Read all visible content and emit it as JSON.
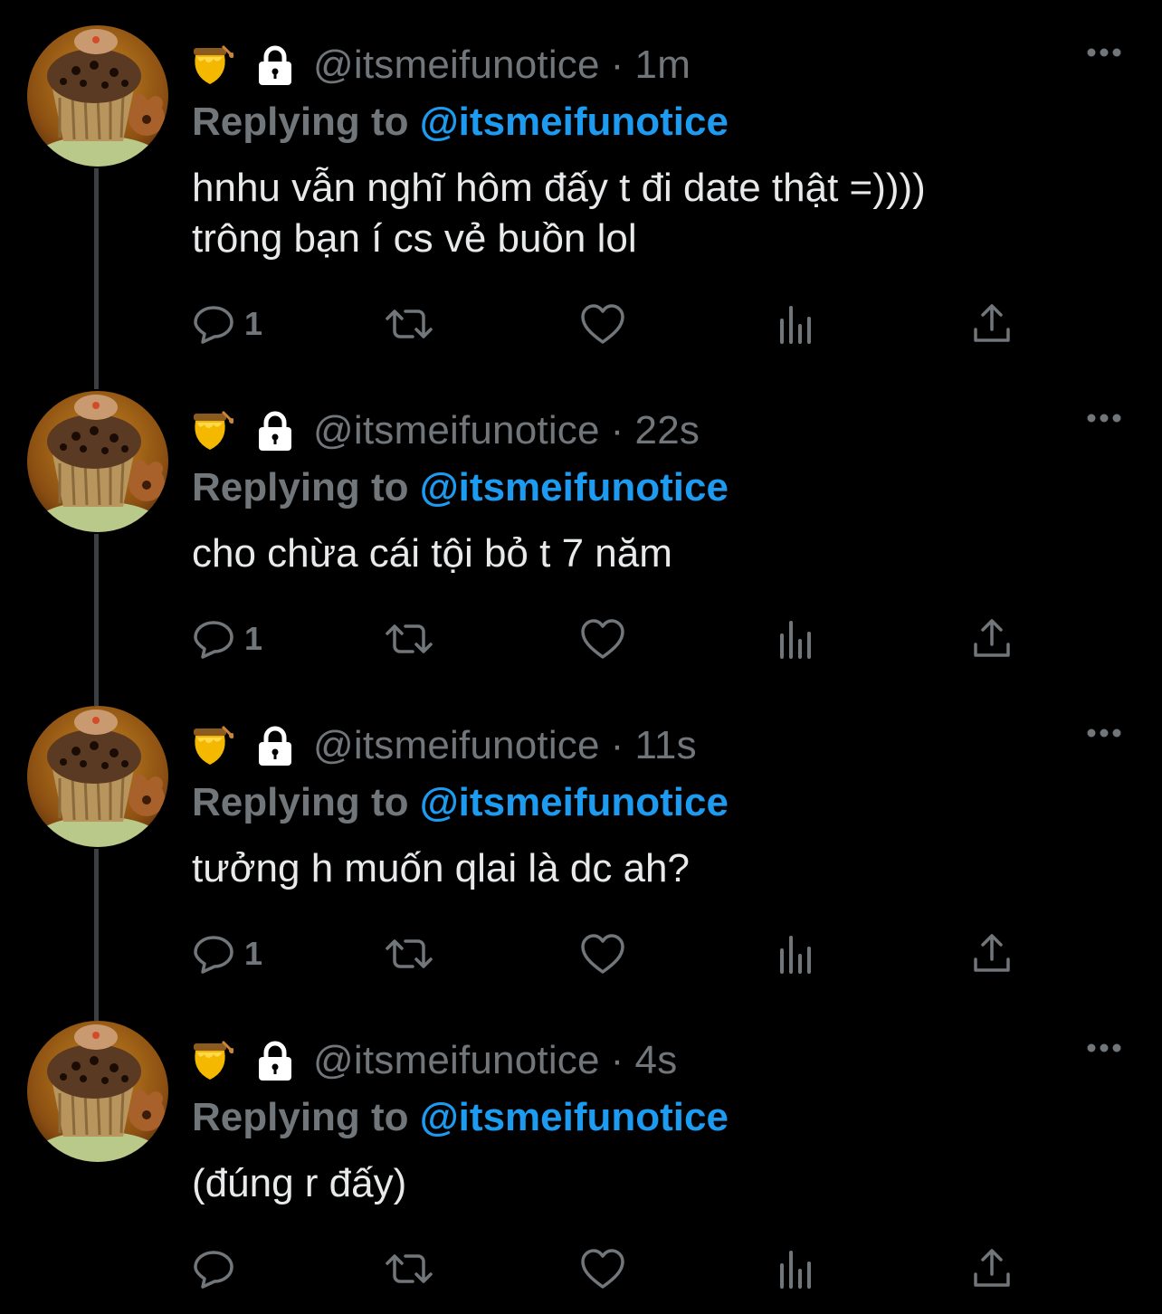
{
  "tweets": [
    {
      "handle": "@itsmeifunotice",
      "dot": "·",
      "time": "1m",
      "replying_prefix": "Replying to ",
      "replying_mention": "@itsmeifunotice",
      "body_lines": [
        "hnhu vẫn nghĩ hôm đấy t đi date thật =))))",
        "trông bạn í cs vẻ buồn lol"
      ],
      "reply_count": "1"
    },
    {
      "handle": "@itsmeifunotice",
      "dot": "·",
      "time": "22s",
      "replying_prefix": "Replying to ",
      "replying_mention": "@itsmeifunotice",
      "body_lines": [
        "cho chừa cái tội bỏ t 7 năm",
        ""
      ],
      "reply_count": "1"
    },
    {
      "handle": "@itsmeifunotice",
      "dot": "·",
      "time": "11s",
      "replying_prefix": "Replying to ",
      "replying_mention": "@itsmeifunotice",
      "body_lines": [
        "tưởng h muốn qlai là dc ah?",
        ""
      ],
      "reply_count": "1"
    },
    {
      "handle": "@itsmeifunotice",
      "dot": "·",
      "time": "4s",
      "replying_prefix": "Replying to ",
      "replying_mention": "@itsmeifunotice",
      "body_lines": [
        "(đúng r đấy)",
        ""
      ],
      "reply_count": ""
    }
  ],
  "colors": {
    "background": "#000000",
    "text": "#e7e9ea",
    "muted": "#71767b",
    "accent": "#1d9bf0",
    "thread_line": "#3b3f44"
  },
  "icons": {
    "badge": "honey-pot-emoji",
    "protected": "lock-icon",
    "more": "more-icon",
    "reply": "reply-icon",
    "retweet": "retweet-icon",
    "like": "like-icon",
    "views": "views-icon",
    "share": "share-icon"
  }
}
